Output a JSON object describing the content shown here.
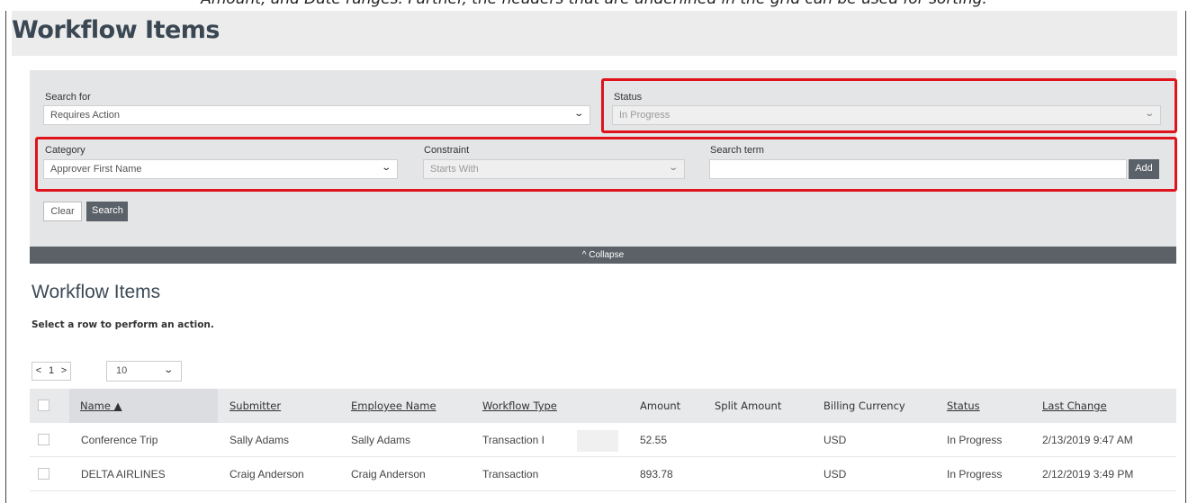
{
  "doc_caption": "Amount, and Date ranges. Further, the headers that are underlined in the grid can be used for sorting.",
  "page_title": "Workflow Items",
  "search_panel": {
    "search_for": {
      "label": "Search for",
      "value": "Requires Action"
    },
    "status": {
      "label": "Status",
      "value": "In Progress"
    },
    "category": {
      "label": "Category",
      "value": "Approver First Name"
    },
    "constraint": {
      "label": "Constraint",
      "value": "Starts With"
    },
    "search_term": {
      "label": "Search term",
      "value": ""
    },
    "add_label": "Add",
    "clear_label": "Clear",
    "search_label": "Search",
    "collapse_label": "^ Collapse"
  },
  "results": {
    "title": "Workflow Items",
    "hint": "Select a row to perform an action.",
    "pager": {
      "prev": "<",
      "page": "1",
      "next": ">"
    },
    "page_size": "10",
    "columns": [
      "Name ▲",
      "Submitter",
      "Employee Name",
      "Workflow Type",
      "Amount",
      "Split Amount",
      "Billing Currency",
      "Status",
      "Last Change"
    ],
    "rows": [
      {
        "name": "Conference Trip",
        "submitter": "Sally Adams",
        "employee": "Sally Adams",
        "type": "Transaction I",
        "amount": "52.55",
        "split": "",
        "currency": "USD",
        "status": "In Progress",
        "last_change": "2/13/2019 9:47 AM"
      },
      {
        "name": "DELTA AIRLINES",
        "submitter": "Craig Anderson",
        "employee": "Craig Anderson",
        "type": "Transaction",
        "amount": "893.78",
        "split": "",
        "currency": "USD",
        "status": "In Progress",
        "last_change": "2/12/2019 3:49 PM"
      }
    ]
  },
  "colors": {
    "highlight": "#e0121b",
    "dark_button": "#5a6168",
    "panel": "#e4e5e6"
  },
  "icons": {
    "dropdown": "chevron-down-icon",
    "sort": "sort-ascending-icon"
  }
}
